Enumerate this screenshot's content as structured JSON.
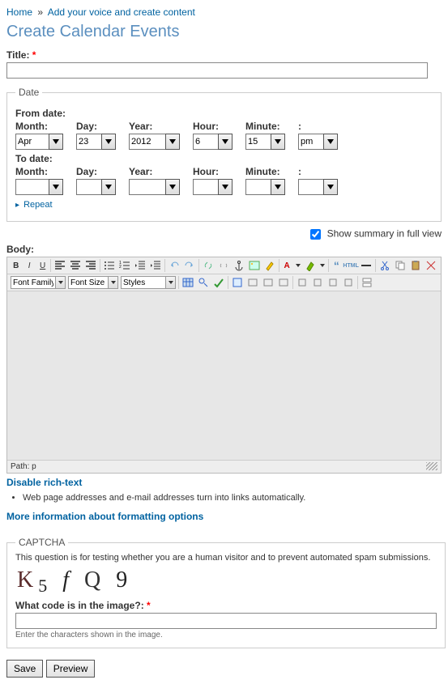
{
  "breadcrumb": {
    "home": "Home",
    "sep": "»",
    "current": "Add your voice and create content"
  },
  "page_title": "Create Calendar Events",
  "title_field": {
    "label": "Title:",
    "value": ""
  },
  "date": {
    "legend": "Date",
    "from_label": "From date:",
    "to_label": "To date:",
    "cols": {
      "month": "Month:",
      "day": "Day:",
      "year": "Year:",
      "hour": "Hour:",
      "minute": "Minute:",
      "colon": ":"
    },
    "from": {
      "month": "Apr",
      "day": "23",
      "year": "2012",
      "hour": "6",
      "minute": "15",
      "ampm": "pm"
    },
    "to": {
      "month": "",
      "day": "",
      "year": "",
      "hour": "",
      "minute": "",
      "ampm": ""
    },
    "repeat": "Repeat"
  },
  "summary": {
    "label": "Show summary in full view",
    "checked": true
  },
  "body": {
    "label": "Body:",
    "font_family": "Font Family",
    "font_size": "Font Size",
    "styles": "Styles",
    "path_label": "Path:",
    "path_value": "p"
  },
  "disable_rich": "Disable rich-text",
  "hint_auto_link": "Web page addresses and e-mail addresses turn into links automatically.",
  "fmt_more": "More information about formatting options",
  "captcha": {
    "legend": "CAPTCHA",
    "desc": "This question is for testing whether you are a human visitor and to prevent automated spam submissions.",
    "chars": [
      "K",
      "5",
      "f",
      "Q",
      "9"
    ],
    "code_label": "What code is in the image?:",
    "hint": "Enter the characters shown in the image."
  },
  "actions": {
    "save": "Save",
    "preview": "Preview"
  }
}
